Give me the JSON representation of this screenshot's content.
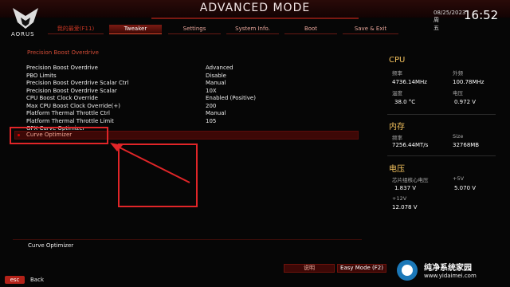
{
  "header": {
    "title": "ADVANCED MODE",
    "logo_text": "AORUS",
    "date": "08/25/2023",
    "weekday": "周五",
    "time": "16:52"
  },
  "tabs": [
    {
      "label": "我的最爱(F11)",
      "active": false
    },
    {
      "label": "Tweaker",
      "active": true
    },
    {
      "label": "Settings",
      "active": false
    },
    {
      "label": "System Info.",
      "active": false
    },
    {
      "label": "Boot",
      "active": false
    },
    {
      "label": "Save & Exit",
      "active": false
    }
  ],
  "section_title": "Precision Boost Overdrive",
  "settings": [
    {
      "label": "Precision Boost Overdrive",
      "value": "Advanced"
    },
    {
      "label": "PBO Limits",
      "value": "Disable"
    },
    {
      "label": "Precision Boost Overdrive Scalar Ctrl",
      "value": "Manual"
    },
    {
      "label": "Precision Boost Overdrive Scalar",
      "value": "10X"
    },
    {
      "label": "CPU Boost Clock Override",
      "value": "Enabled (Positive)"
    },
    {
      "label": "Max CPU Boost Clock Override(+)",
      "value": "200"
    },
    {
      "label": "Platform Thermal Throttle Ctrl",
      "value": "Manual"
    },
    {
      "label": "Platform Thermal Throttle Limit",
      "value": "105"
    },
    {
      "label": "GFX Curve Optimizer",
      "value": ""
    }
  ],
  "selected_item": "Curve Optimizer",
  "help_text": "Curve Optimizer",
  "footer": {
    "esc_label": "esc",
    "back_label": "Back",
    "help_label": "说明",
    "easy_mode_label": "Easy Mode (F2)"
  },
  "cpu": {
    "title": "CPU",
    "freq_label": "频率",
    "freq_value": "4736.14MHz",
    "ext_label": "外频",
    "ext_value": "100.78MHz",
    "temp_label": "温度",
    "temp_value": "38.0 °C",
    "volt_label": "电压",
    "volt_value": "0.972 V"
  },
  "memory": {
    "title": "内存",
    "freq_label": "频率",
    "freq_value": "7256.44MT/s",
    "size_label": "Size",
    "size_value": "32768MB"
  },
  "voltage": {
    "title": "电压",
    "core_label": "芯片组核心电压",
    "core_value": "1.837 V",
    "plus5_label": "+5V",
    "plus5_value": "5.070 V",
    "plus12_label": "+12V",
    "plus12_value": "12.078 V"
  },
  "watermark": {
    "text": "纯净系统家园",
    "url": "www.yidaimei.com"
  },
  "colors": {
    "accent": "#c0281b",
    "panel_heading": "#f3c15d",
    "annotation": "#e02528"
  }
}
